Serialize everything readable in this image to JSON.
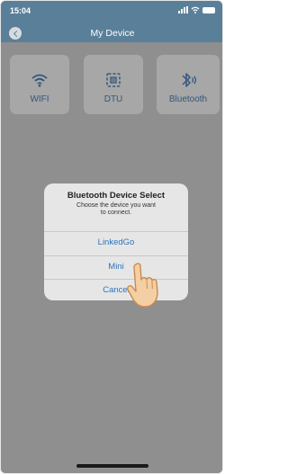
{
  "status_bar": {
    "time": "15:04"
  },
  "nav": {
    "title": "My Device"
  },
  "cards": [
    {
      "label": "WIFI",
      "icon": "wifi-icon"
    },
    {
      "label": "DTU",
      "icon": "dtu-icon"
    },
    {
      "label": "Bluetooth",
      "icon": "bluetooth-icon"
    }
  ],
  "dialog": {
    "title": "Bluetooth Device Select",
    "subtitle_line1": "Choose the device you want",
    "subtitle_line2": "to connect.",
    "options": [
      "LinkedGo",
      "Mini",
      "Cancel"
    ]
  },
  "colors": {
    "nav_bg": "#5a7f99",
    "overlay": "#8f8f8f",
    "card_label": "#32567a",
    "dialog_option": "#2f74b8"
  }
}
